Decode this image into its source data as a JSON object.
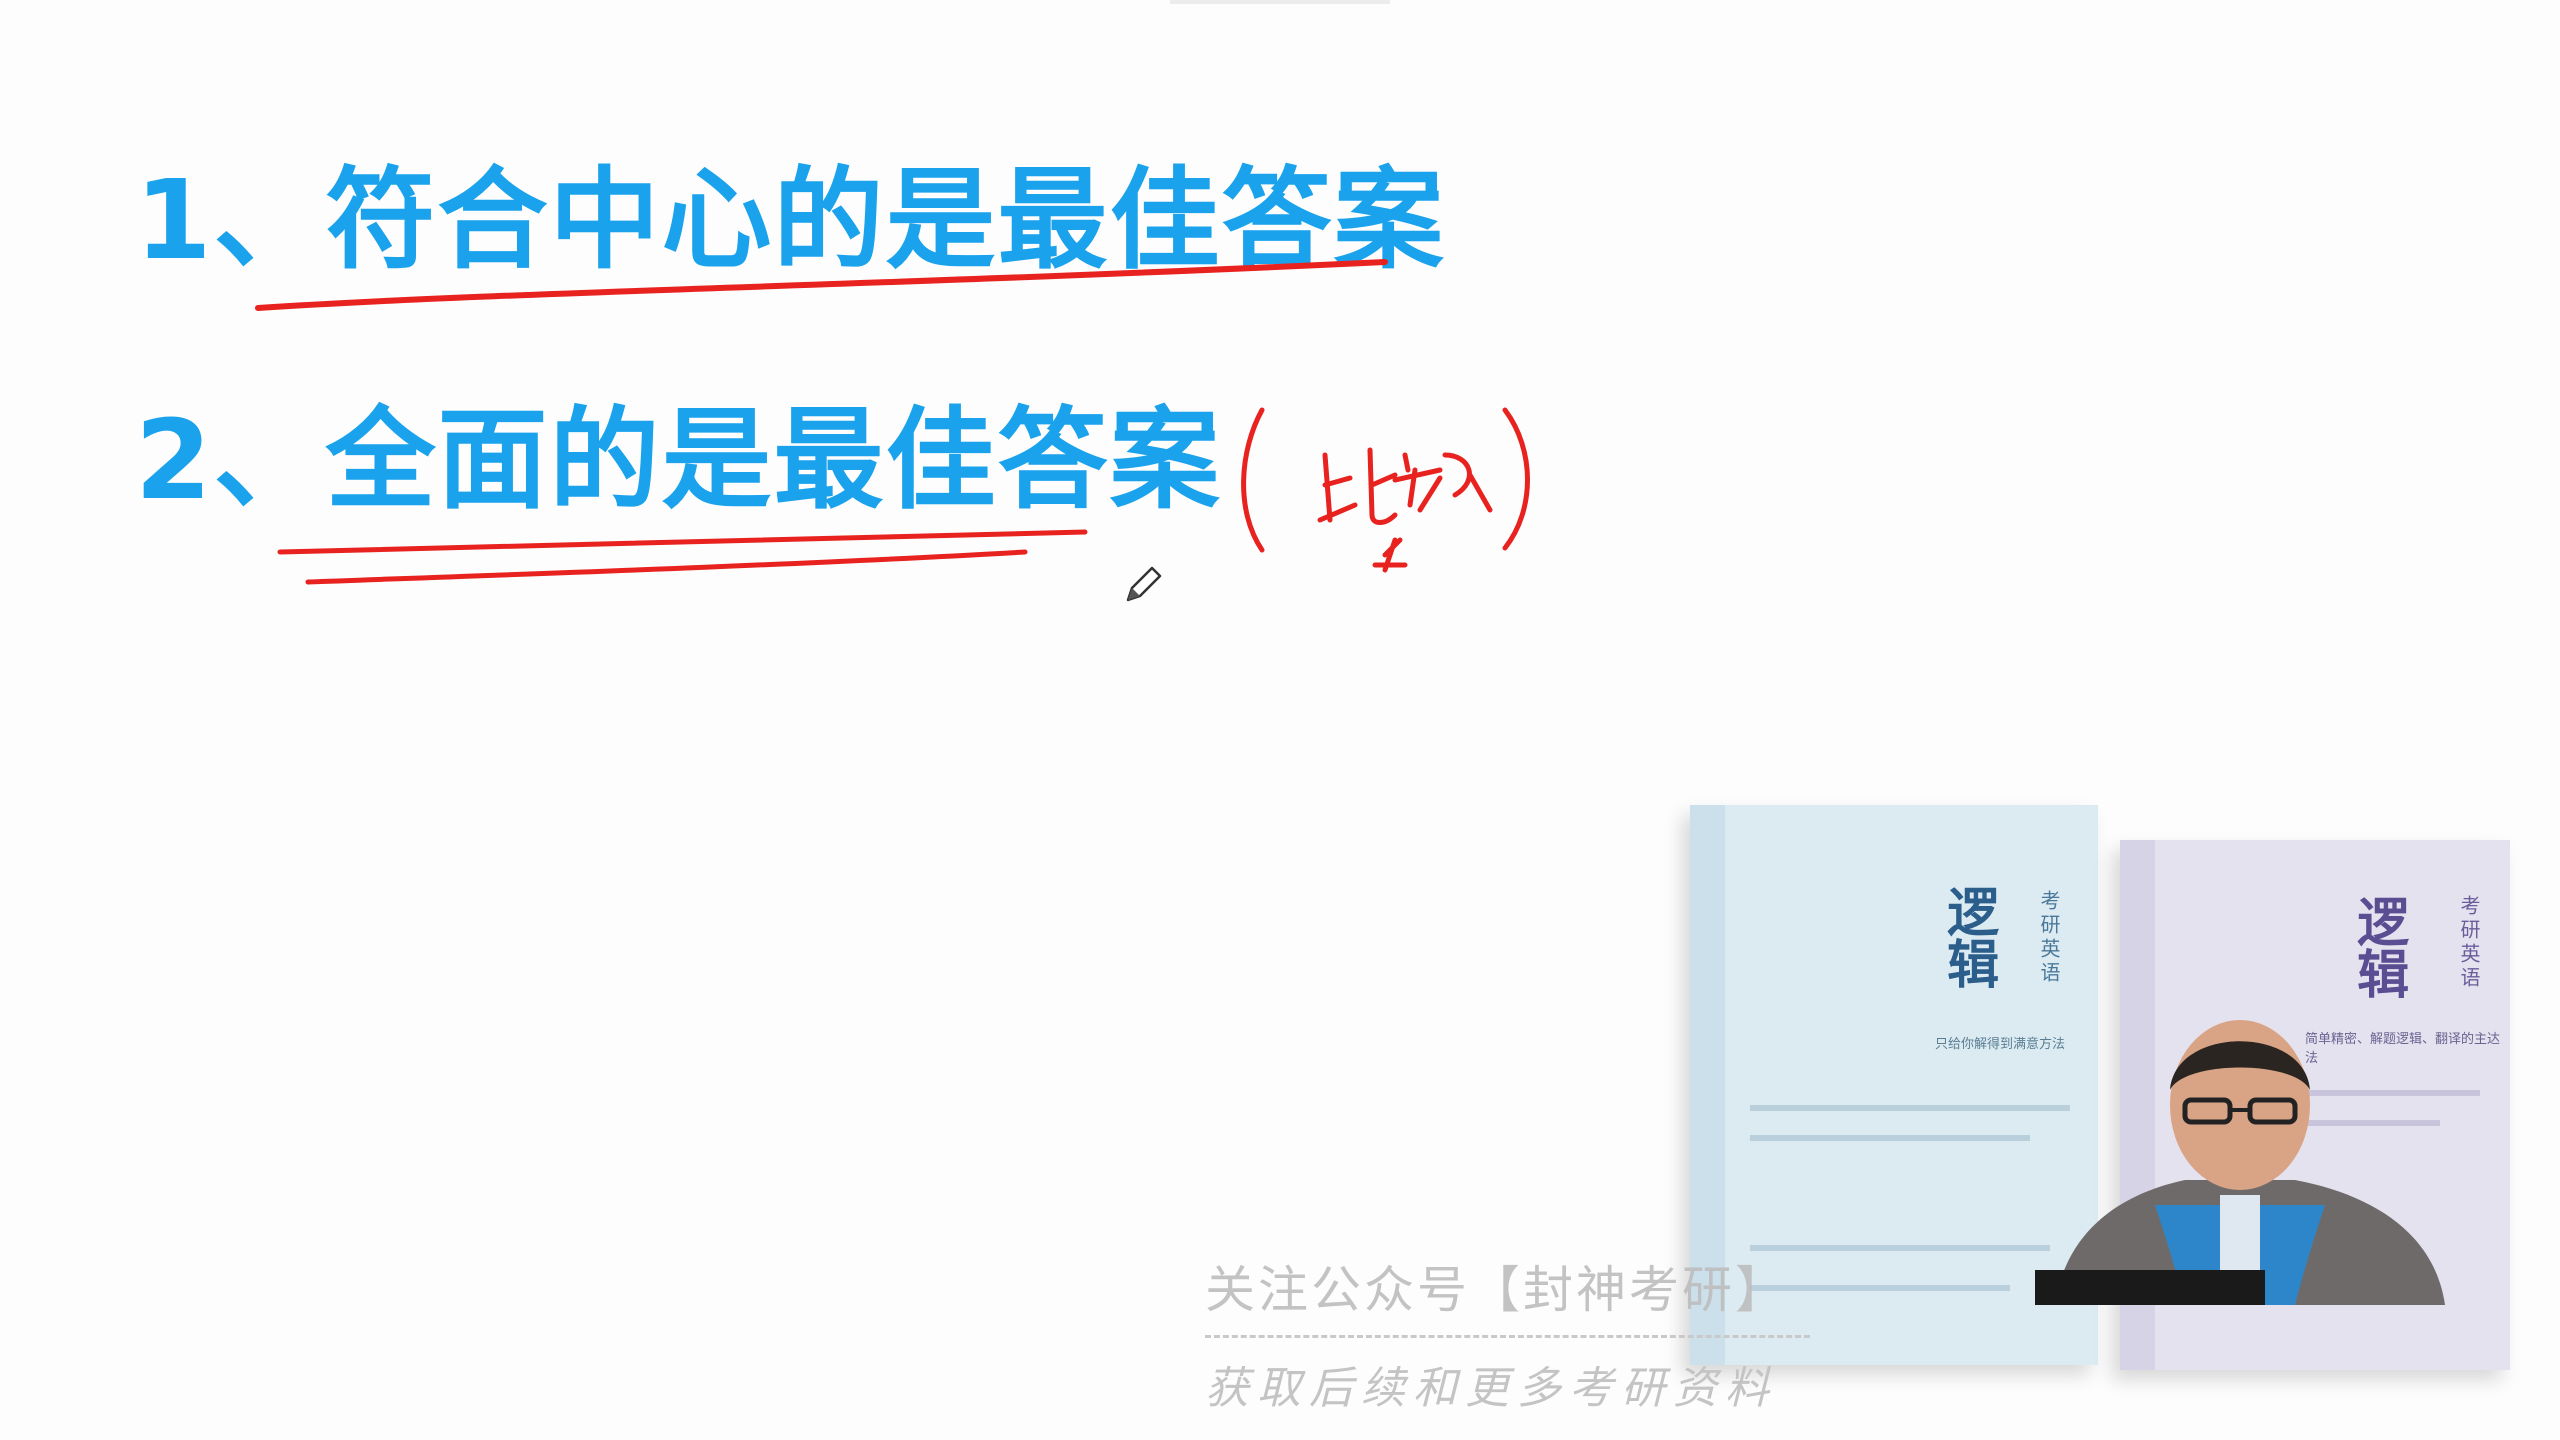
{
  "slide": {
    "points": [
      {
        "label": "1、符合中心的是最佳答案"
      },
      {
        "label": "2、全面的是最佳答案"
      }
    ],
    "handwritten_note": "(比较)"
  },
  "books": [
    {
      "title": "逻辑",
      "series": "考研英语",
      "tagline": "只给你解得到满意方法"
    },
    {
      "title": "逻辑",
      "series": "考研英语",
      "tagline": "简单精密、解题逻辑、翻译的主达法"
    }
  ],
  "watermark": {
    "line1": "关注公众号【封神考研】",
    "line2": "获取后续和更多考研资料"
  },
  "colors": {
    "heading_blue": "#1aa3ec",
    "ink_red": "#e8221f",
    "background": "#fdfdfd"
  },
  "icons": {
    "cursor": "pen-cursor-icon"
  }
}
